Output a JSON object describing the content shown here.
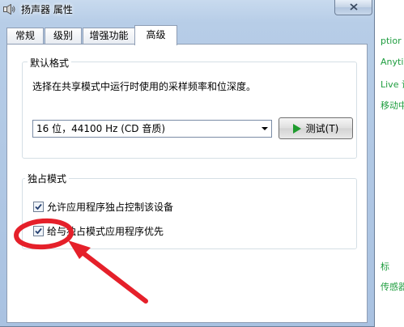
{
  "window": {
    "title": "扬声器 属性"
  },
  "tabs": [
    {
      "label": "常规"
    },
    {
      "label": "级别"
    },
    {
      "label": "增强功能"
    },
    {
      "label": "高级"
    }
  ],
  "default_format": {
    "group_title": "默认格式",
    "description": "选择在共享模式中运行时使用的采样频率和位深度。",
    "selected_format": "16 位，44100 Hz (CD 音质)",
    "test_button": "测试(T)"
  },
  "exclusive_mode": {
    "group_title": "独占模式",
    "allow_control": {
      "label": "允许应用程序独占控制该设备",
      "checked": true
    },
    "give_priority": {
      "label": "给与独占模式应用程序优先",
      "checked": true
    }
  },
  "background_window": {
    "lines": [
      "ptior",
      "Anytir",
      "Live 设",
      "移动中",
      "标",
      "传感器"
    ]
  },
  "colors": {
    "annotation_red": "#e5202a",
    "accent_green": "#1f9d3f"
  }
}
